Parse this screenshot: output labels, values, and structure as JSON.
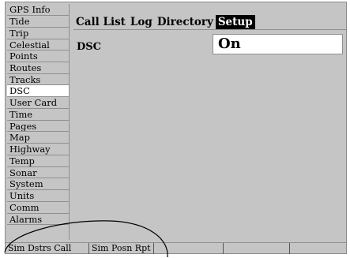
{
  "sidebar": {
    "items": [
      {
        "label": "GPS Info",
        "selected": false
      },
      {
        "label": "Tide",
        "selected": false
      },
      {
        "label": "Trip",
        "selected": false
      },
      {
        "label": "Celestial",
        "selected": false
      },
      {
        "label": "Points",
        "selected": false
      },
      {
        "label": "Routes",
        "selected": false
      },
      {
        "label": "Tracks",
        "selected": false
      },
      {
        "label": "DSC",
        "selected": true
      },
      {
        "label": "User Card",
        "selected": false
      },
      {
        "label": "Time",
        "selected": false
      },
      {
        "label": "Pages",
        "selected": false
      },
      {
        "label": "Map",
        "selected": false
      },
      {
        "label": "Highway",
        "selected": false
      },
      {
        "label": "Temp",
        "selected": false
      },
      {
        "label": "Sonar",
        "selected": false
      },
      {
        "label": "System",
        "selected": false
      },
      {
        "label": "Units",
        "selected": false
      },
      {
        "label": "Comm",
        "selected": false
      },
      {
        "label": "Alarms",
        "selected": false
      }
    ]
  },
  "tabs": [
    {
      "label": "Call List",
      "selected": false
    },
    {
      "label": "Log",
      "selected": false
    },
    {
      "label": "Directory",
      "selected": false
    },
    {
      "label": "Setup",
      "selected": true
    }
  ],
  "setup": {
    "dsc_label": "DSC",
    "dsc_value": "On"
  },
  "softkeys": [
    {
      "label": "Sim Dstrs Call"
    },
    {
      "label": "Sim Posn Rpt"
    },
    {
      "label": ""
    },
    {
      "label": ""
    },
    {
      "label": ""
    }
  ],
  "colors": {
    "background": "#c5c5c5",
    "selected_item": "#ffffff",
    "selected_tab": "#000000",
    "divider": "#8f8f8f"
  }
}
